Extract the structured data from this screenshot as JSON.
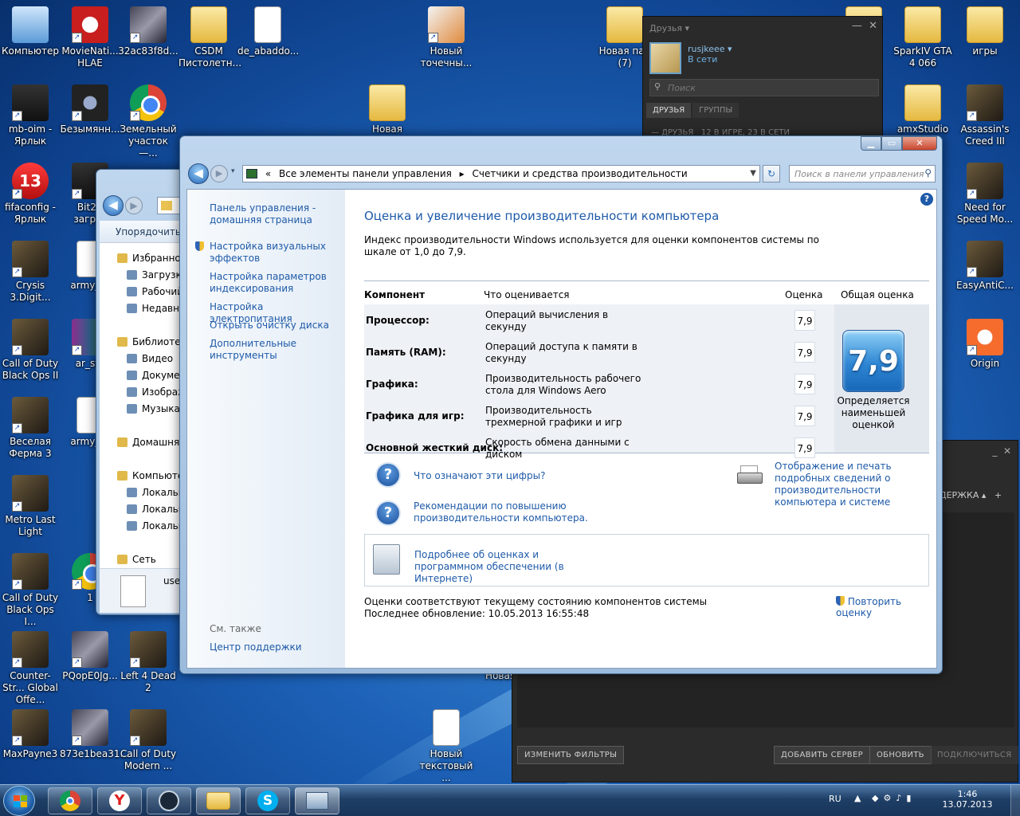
{
  "desktop": {
    "icons_left": [
      {
        "label": "Компьютер",
        "kind": "computer"
      },
      {
        "label": "MovieNati... HLAE",
        "kind": "app-red"
      },
      {
        "label": "32ac83f8d...",
        "kind": "image"
      },
      {
        "label": "CSDM Пистолетн...",
        "kind": "folder"
      },
      {
        "label": "de_abaddo...",
        "kind": "file"
      },
      {
        "label": "Новый точечны...",
        "kind": "paint"
      },
      {
        "label": "mb-oim - Ярлык",
        "kind": "dark"
      },
      {
        "label": "Безымянн...",
        "kind": "camera"
      },
      {
        "label": "Земельный участок —...",
        "kind": "chrome"
      },
      {
        "label": "Новая папка",
        "kind": "folder"
      },
      {
        "label": "fifaconfig - Ярлык",
        "kind": "red13"
      },
      {
        "label": "Bit2B загруз",
        "kind": "dark"
      },
      {
        "label": "Crysis 3.Digit...",
        "kind": "game"
      },
      {
        "label": "army_ra",
        "kind": "file"
      },
      {
        "label": "Call of Duty Black Ops II",
        "kind": "game"
      },
      {
        "label": "ar_sta",
        "kind": "winrar"
      },
      {
        "label": "Веселая Ферма 3",
        "kind": "game"
      },
      {
        "label": "army_ra",
        "kind": "file"
      },
      {
        "label": "Metro Last Light",
        "kind": "game"
      },
      {
        "label": "Call of Duty Black Ops I...",
        "kind": "game"
      },
      {
        "label": "1",
        "kind": "chrome"
      },
      {
        "label": "Counter-Str... Global Offe...",
        "kind": "game"
      },
      {
        "label": "PQopE0Jg...",
        "kind": "image"
      },
      {
        "label": "Left 4 Dead 2",
        "kind": "game"
      },
      {
        "label": "MaxPayne3",
        "kind": "game"
      },
      {
        "label": "873e1bea31...",
        "kind": "image"
      },
      {
        "label": "Call of Duty Modern ...",
        "kind": "game"
      },
      {
        "label": "Новый текстовый ...",
        "kind": "file"
      },
      {
        "label": "Новая (б",
        "kind": "folder"
      }
    ],
    "icons_right": [
      {
        "label": "Новая пап (7)",
        "kind": "folder"
      },
      {
        "label": "SparkIV GTA 4 066",
        "kind": "folder"
      },
      {
        "label": "игры",
        "kind": "folder"
      },
      {
        "label": "amxStudio",
        "kind": "folder"
      },
      {
        "label": "Assassin's Creed III",
        "kind": "game"
      },
      {
        "label": "Need for Speed Mo...",
        "kind": "game"
      },
      {
        "label": "EasyAntiC...",
        "kind": "game"
      },
      {
        "label": "Origin",
        "kind": "origin"
      },
      {
        "label": "ка",
        "kind": "folder"
      }
    ]
  },
  "steam_friends": {
    "title": "Друзья",
    "username": "rusjkeee",
    "status": "В сети",
    "search_placeholder": "Поиск",
    "tabs": [
      "ДРУЗЬЯ",
      "ГРУППЫ"
    ],
    "list_header": "ДРУЗЬЯ",
    "in_game": "12 В ИГРЕ",
    "online": "23 В СЕТИ"
  },
  "steam_servers": {
    "tab_support": "ДЕРЖКА",
    "btn_filters": "ИЗМЕНИТЬ ФИЛЬТРЫ",
    "btn_add_server": "ДОБАВИТЬ СЕРВЕР",
    "btn_refresh": "ОБНОВИТЬ",
    "btn_connect": "ПОДКЛЮЧИТЬСЯ"
  },
  "explorer": {
    "organize": "Упорядочить",
    "nav": [
      {
        "label": "Избранное",
        "level": 0
      },
      {
        "label": "Загрузки",
        "level": 1
      },
      {
        "label": "Рабочий",
        "level": 1
      },
      {
        "label": "Недавни",
        "level": 1
      },
      {
        "label": "Библиотек",
        "level": 0
      },
      {
        "label": "Видео",
        "level": 1
      },
      {
        "label": "Докумен",
        "level": 1
      },
      {
        "label": "Изображ",
        "level": 1
      },
      {
        "label": "Музыка",
        "level": 1
      },
      {
        "label": "Домашняя",
        "level": 0
      },
      {
        "label": "Компьюте",
        "level": 0
      },
      {
        "label": "Локальн",
        "level": 1
      },
      {
        "label": "Локальн",
        "level": 1
      },
      {
        "label": "Локальн",
        "level": 1
      },
      {
        "label": "Сеть",
        "level": 0
      }
    ],
    "file_label": "use"
  },
  "cpanel": {
    "breadcrumb_1": "Все элементы панели управления",
    "breadcrumb_2": "Счетчики и средства производительности",
    "search_placeholder": "Поиск в панели управления",
    "sidebar": {
      "home": "Панель управления - домашняя страница",
      "links": [
        "Настройка визуальных эффектов",
        "Настройка параметров индексирования",
        "Настройка электропитания",
        "Открыть очистку диска",
        "Дополнительные инструменты"
      ],
      "see_also": "См. также",
      "support": "Центр поддержки"
    },
    "heading": "Оценка и увеличение производительности компьютера",
    "intro": "Индекс производительности Windows используется для оценки компонентов системы по шкале от 1,0 до 7,9.",
    "table": {
      "col_component": "Компонент",
      "col_what": "Что оценивается",
      "col_score": "Оценка",
      "col_total": "Общая оценка",
      "rows": [
        {
          "component": "Процессор:",
          "what": "Операций вычисления в секунду",
          "score": "7,9"
        },
        {
          "component": "Память (RAM):",
          "what": "Операций доступа к памяти в секунду",
          "score": "7,9"
        },
        {
          "component": "Графика:",
          "what": "Производительность рабочего стола для Windows Aero",
          "score": "7,9"
        },
        {
          "component": "Графика для игр:",
          "what": "Производительность трехмерной графики и игр",
          "score": "7,9"
        },
        {
          "component": "Основной жесткий диск:",
          "what": "Скорость обмена данными с диском",
          "score": "7,9"
        }
      ],
      "total_score": "7,9",
      "total_caption": "Определяется наименьшей оценкой"
    },
    "help_1": "Что означают эти цифры?",
    "help_2": "Рекомендации по повышению производительности компьютера.",
    "print_link": "Отображение и печать подробных сведений о производительности компьютера и системе",
    "more_info": "Подробнее об оценках и программном обеспечении (в Интернете)",
    "status_1": "Оценки соответствуют текущему состоянию компонентов системы",
    "status_2": "Последнее обновление: 10.05.2013 16:55:48",
    "rerun": "Повторить оценку"
  },
  "taskbar": {
    "lang": "RU",
    "time": "1:46",
    "date": "13.07.2013"
  },
  "colors": {
    "link": "#1e5aa8",
    "heading": "#1e5aa8",
    "steam_bg": "#2b2b2b"
  }
}
